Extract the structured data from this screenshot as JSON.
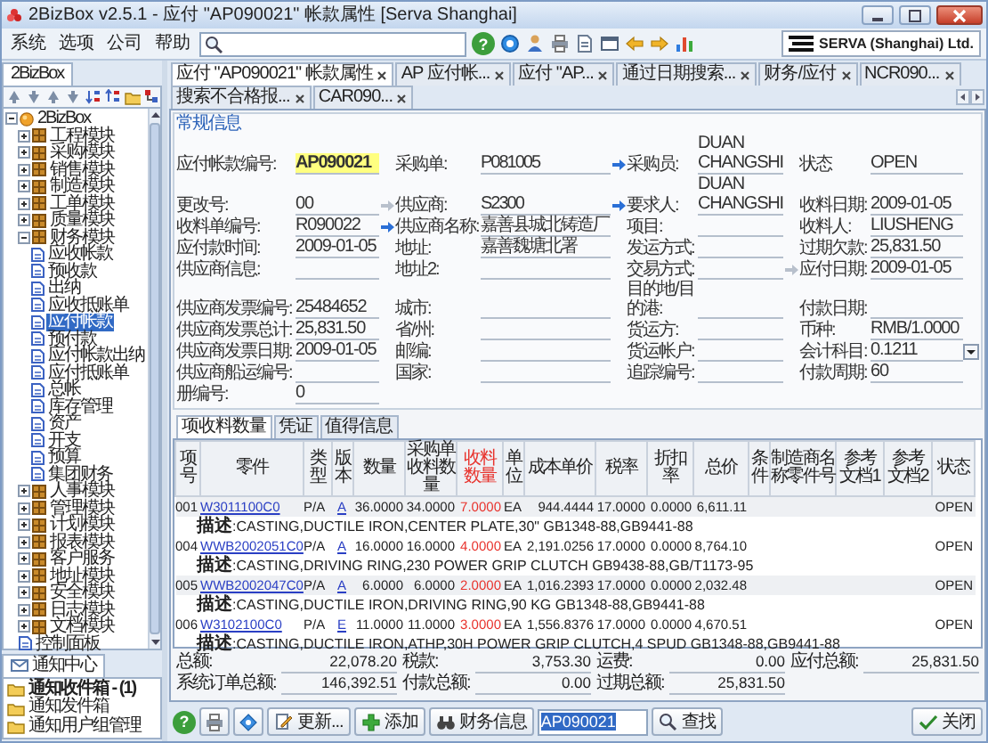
{
  "window": {
    "title": "2BizBox v2.5.1 - 应付 \"AP090021\" 帐款属性  [Serva Shanghai]"
  },
  "menu": [
    "系统",
    "选项",
    "公司",
    "帮助"
  ],
  "top_help": "?",
  "logo": {
    "text": "SERVA (Shanghai) Ltd."
  },
  "nav": {
    "tab": {
      "label": "2BizBox",
      "selected": true
    },
    "tree": [
      {
        "label": "2BizBox",
        "kind": "root",
        "expanded": true,
        "selected": false,
        "children": [
          {
            "label": "工程模块",
            "kind": "module",
            "expanded": false,
            "selected": false
          },
          {
            "label": "采购模块",
            "kind": "module",
            "expanded": false,
            "selected": false
          },
          {
            "label": "销售模块",
            "kind": "module",
            "expanded": false,
            "selected": false
          },
          {
            "label": "制造模块",
            "kind": "module",
            "expanded": false,
            "selected": false
          },
          {
            "label": "工单模块",
            "kind": "module",
            "expanded": false,
            "selected": false
          },
          {
            "label": "质量模块",
            "kind": "module",
            "expanded": false,
            "selected": false
          },
          {
            "label": "财务模块",
            "kind": "module",
            "expanded": true,
            "selected": false,
            "children": [
              {
                "label": "应收帐款",
                "kind": "page",
                "selected": false
              },
              {
                "label": "预收款",
                "kind": "page",
                "selected": false
              },
              {
                "label": "出纳",
                "kind": "page",
                "selected": false
              },
              {
                "label": "应收抵账单",
                "kind": "page",
                "selected": false
              },
              {
                "label": "应付帐款",
                "kind": "page",
                "selected": true
              },
              {
                "label": "预付款",
                "kind": "page",
                "selected": false
              },
              {
                "label": "应付帐款出纳",
                "kind": "page",
                "selected": false
              },
              {
                "label": "应付抵账单",
                "kind": "page",
                "selected": false
              },
              {
                "label": "总帐",
                "kind": "page",
                "selected": false
              },
              {
                "label": "库存管理",
                "kind": "page",
                "selected": false
              },
              {
                "label": "资产",
                "kind": "page",
                "selected": false
              },
              {
                "label": "开支",
                "kind": "page",
                "selected": false
              },
              {
                "label": "预算",
                "kind": "page",
                "selected": false
              },
              {
                "label": "集团财务",
                "kind": "page",
                "selected": false
              }
            ]
          },
          {
            "label": "人事模块",
            "kind": "module",
            "expanded": false,
            "selected": false
          },
          {
            "label": "管理模块",
            "kind": "module",
            "expanded": false,
            "selected": false
          },
          {
            "label": "计划模块",
            "kind": "module",
            "expanded": false,
            "selected": false
          },
          {
            "label": "报表模块",
            "kind": "module",
            "expanded": false,
            "selected": false
          },
          {
            "label": "客户服务",
            "kind": "module",
            "expanded": false,
            "selected": false
          },
          {
            "label": "地址模块",
            "kind": "module",
            "expanded": false,
            "selected": false
          },
          {
            "label": "安全模块",
            "kind": "module",
            "expanded": false,
            "selected": false
          },
          {
            "label": "日志模块",
            "kind": "module",
            "expanded": false,
            "selected": false
          },
          {
            "label": "文档模块",
            "kind": "module",
            "expanded": false,
            "selected": false
          },
          {
            "label": "控制面板",
            "kind": "page",
            "selected": false
          }
        ]
      }
    ]
  },
  "notifications": {
    "tab": {
      "label": "通知中心",
      "selected": true
    },
    "items": [
      {
        "label": "通知收件箱 - (1)",
        "unread": true
      },
      {
        "label": "通知发件箱",
        "unread": false
      },
      {
        "label": "通知用户组管理",
        "unread": false
      }
    ]
  },
  "doc_tabs": [
    {
      "label": "应付 \"AP090021\" 帐款属性",
      "selected": true
    },
    {
      "label": "AP 应付帐...",
      "selected": false
    },
    {
      "label": "应付 \"AP...",
      "selected": false
    },
    {
      "label": "通过日期搜索...",
      "selected": false
    },
    {
      "label": "财务/应付",
      "selected": false
    },
    {
      "label": "NCR090...",
      "selected": false
    },
    {
      "label": "搜索不合格报...",
      "selected": false
    },
    {
      "label": "CAR090...",
      "selected": false
    }
  ],
  "general_info": {
    "title": "常规信息",
    "rows": [
      [
        {
          "label": "应付帐款编号:",
          "value": "AP090021",
          "highlighted": true
        },
        {
          "label": "采购单:",
          "value": "P081005",
          "button": {
            "kind": "arrow",
            "disabled": false
          }
        },
        {
          "label": "采购员:",
          "value": "DUAN CHANGSHI"
        },
        {
          "label": "状态",
          "value": "OPEN"
        }
      ],
      [
        {
          "label": "更改号:",
          "value": "00",
          "button": {
            "kind": "arrow",
            "disabled": true
          }
        },
        {
          "label": "供应商:",
          "value": "S2300",
          "button": {
            "kind": "arrow",
            "disabled": false
          }
        },
        {
          "label": "要求人:",
          "value": "DUAN CHANGSHI"
        },
        {
          "label": "收料日期:",
          "value": "2009-01-05"
        }
      ],
      [
        {
          "label": "收料单编号:",
          "value": "R090022",
          "button": {
            "kind": "arrow",
            "disabled": false
          }
        },
        {
          "label": "供应商名称:",
          "value": "嘉善县城北铸造厂"
        },
        {
          "label": "项目:"
        },
        {
          "label": "收料人:",
          "value": "LIUSHENG"
        }
      ],
      [
        {
          "label": "应付款时间:",
          "value": "2009-01-05"
        },
        {
          "label": "地址:",
          "value": "嘉善魏塘北署"
        },
        {
          "label": "发运方式:"
        },
        {
          "label": "过期欠款:",
          "value": "25,831.50"
        }
      ],
      [
        {
          "label": "供应商信息:"
        },
        {
          "label": "地址2:"
        },
        {
          "label": "交易方式:",
          "button": {
            "kind": "arrow",
            "disabled": true
          }
        },
        {
          "label": "应付日期:",
          "value": "2009-01-05"
        }
      ],
      [
        {
          "label": "供应商发票编号:",
          "value": "25484652"
        },
        {
          "label": "城市:"
        },
        {
          "label": "目的地/目的港:"
        },
        {
          "label": "付款日期:"
        }
      ],
      [
        {
          "label": "供应商发票总计:",
          "value": "25,831.50"
        },
        {
          "label": "省/州:"
        },
        {
          "label": "货运方:"
        },
        {
          "label": "币种:",
          "value": "RMB/1.0000"
        }
      ],
      [
        {
          "label": "供应商发票日期:",
          "value": "2009-01-05"
        },
        {
          "label": "邮编:"
        },
        {
          "label": "货运帐户:"
        },
        {
          "label": "会计科目:",
          "value": "0.1211",
          "button": {
            "kind": "dropdown"
          }
        }
      ],
      [
        {
          "label": "供应商船运编号:"
        },
        {
          "label": "国家:"
        },
        {
          "label": "追踪编号:"
        },
        {
          "label": "付款周期:",
          "value": "60"
        }
      ],
      [
        {
          "label": "册编号:",
          "value": "0"
        }
      ]
    ]
  },
  "detail_tabs": [
    {
      "label": "项收料数量",
      "selected": true
    },
    {
      "label": "凭证",
      "selected": false
    },
    {
      "label": "值得信息",
      "selected": false
    }
  ],
  "table": {
    "columns": [
      {
        "label": "项号"
      },
      {
        "label": "零件",
        "link": true
      },
      {
        "label": "类型"
      },
      {
        "label": "版本",
        "link": true
      },
      {
        "label": "数量"
      },
      {
        "label": "采购单收料数量"
      },
      {
        "label": "收料数量",
        "color": "#e8322c"
      },
      {
        "label": "单位"
      },
      {
        "label": "成本单价"
      },
      {
        "label": "税率"
      },
      {
        "label": "折扣率"
      },
      {
        "label": "总价"
      },
      {
        "label": "条件"
      },
      {
        "label": "制造商名称零件号"
      },
      {
        "label": "参考文档1"
      },
      {
        "label": "参考文档2"
      },
      {
        "label": "状态"
      }
    ],
    "rows": [
      {
        "item": "001",
        "part": "W3011100C0",
        "type": "P/A",
        "rev": "A",
        "qty": "36.0000",
        "po_qty": "34.0000",
        "received_qty": "7.0000",
        "unit": "EA",
        "unit_cost": "944.4444",
        "tax_rate": "17.0000",
        "discount_rate": "0.0000",
        "total": "6,611.11",
        "status": "OPEN",
        "description": "**描述**:CASTING,DUCTILE IRON,CENTER PLATE,30\" GB1348-88,GB9441-88"
      },
      {
        "item": "004",
        "part": "WWB2002051C0",
        "type": "P/A",
        "rev": "A",
        "qty": "16.0000",
        "po_qty": "16.0000",
        "received_qty": "4.0000",
        "unit": "EA",
        "unit_cost": "2,191.0256",
        "tax_rate": "17.0000",
        "discount_rate": "0.0000",
        "total": "8,764.10",
        "status": "OPEN",
        "description": "**描述**:CASTING,DRIVING RING,230 POWER GRIP CLUTCH  GB9438-88,GB/T1173-95"
      },
      {
        "item": "005",
        "part": "WWB2002047C0",
        "type": "P/A",
        "rev": "A",
        "qty": "6.0000",
        "po_qty": "6.0000",
        "received_qty": "2.0000",
        "unit": "EA",
        "unit_cost": "1,016.2393",
        "tax_rate": "17.0000",
        "discount_rate": "0.0000",
        "total": "2,032.48",
        "status": "OPEN",
        "description": "**描述**:CASTING,DUCTILE IRON,DRIVING RING,90 KG  GB1348-88,GB9441-88"
      },
      {
        "item": "006",
        "part": "W3102100C0",
        "type": "P/A",
        "rev": "E",
        "qty": "11.0000",
        "po_qty": "11.0000",
        "received_qty": "3.0000",
        "unit": "EA",
        "unit_cost": "1,556.8376",
        "tax_rate": "17.0000",
        "discount_rate": "0.0000",
        "total": "4,670.51",
        "status": "OPEN",
        "description": "**描述**:CASTING,DUCTILE IRON,ATHP,30H POWER GRIP CLUTCH,4 SPUD  GB1348-88,GB9441-88"
      }
    ]
  },
  "totals": [
    {
      "label": "总额:",
      "value": "22,078.20"
    },
    {
      "label": "税款:",
      "value": "3,753.30"
    },
    {
      "label": "运费:",
      "value": "0.00"
    },
    {
      "label": "应付总额:",
      "value": "25,831.50"
    },
    {
      "label": "系统订单总额:",
      "value": "146,392.51"
    },
    {
      "label": "付款总额:",
      "value": "0.00"
    },
    {
      "label": "过期总额:",
      "value": "25,831.50"
    }
  ],
  "toolbar": {
    "help": "?",
    "buttons": [
      {
        "label": "更新...",
        "kind": "edit"
      },
      {
        "label": "添加",
        "kind": "add"
      },
      {
        "label": "财务信息",
        "kind": "info"
      }
    ],
    "search": {
      "value": "AP090021"
    },
    "find": {
      "label": "查找"
    },
    "close": {
      "label": "关闭"
    }
  }
}
